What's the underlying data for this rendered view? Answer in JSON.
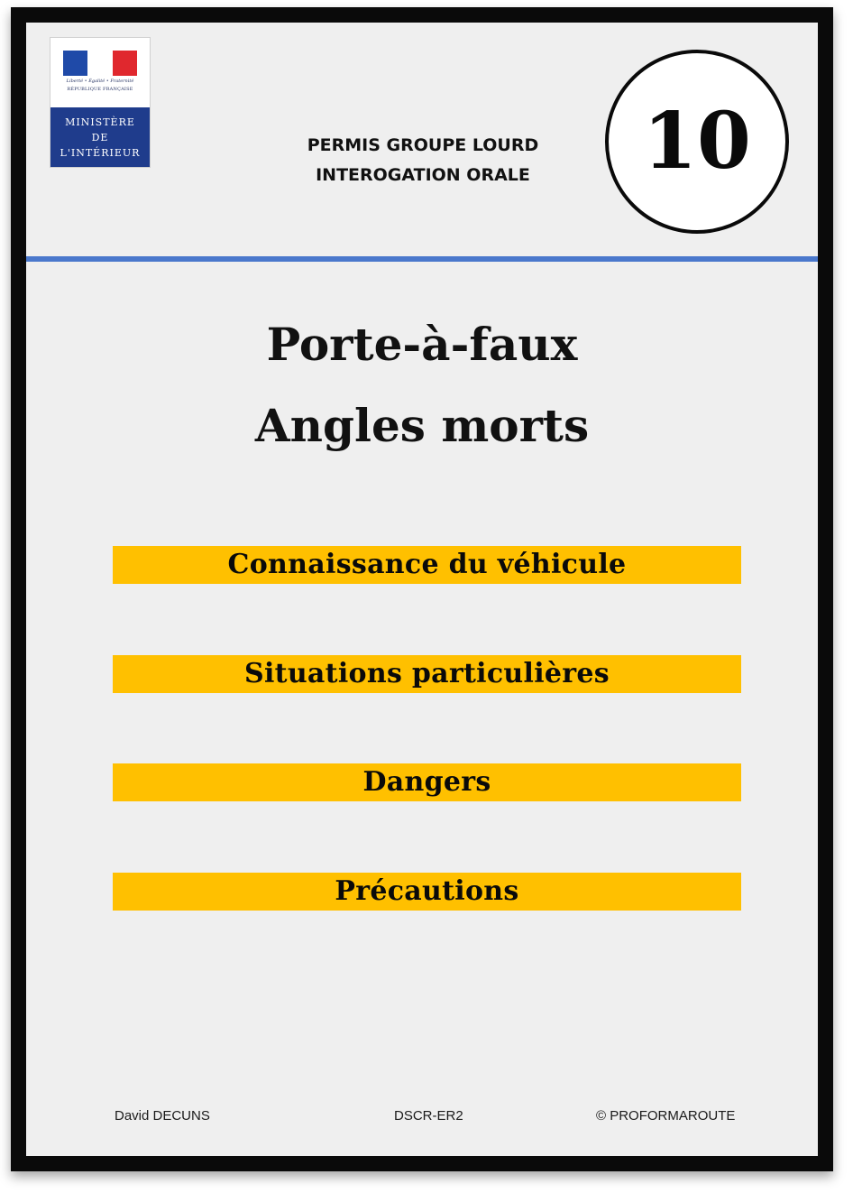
{
  "logo": {
    "motto": "Liberté • Égalité • Fraternité",
    "republique": "RÉPUBLIQUE FRANÇAISE",
    "ministry_lines": [
      "MINISTÈRE",
      "DE",
      "L'INTÉRIEUR"
    ],
    "flag_colors": [
      "#1f4aa8",
      "#ffffff",
      "#e0282e"
    ]
  },
  "header": {
    "line1": "PERMIS GROUPE LOURD",
    "line2": "INTEROGATION ORALE"
  },
  "badge": {
    "number": "10"
  },
  "title": {
    "line1": "Porte-à-faux",
    "line2": "Angles morts"
  },
  "topics": [
    "Connaissance du véhicule",
    "Situations particulières",
    "Dangers",
    "Précautions"
  ],
  "footer": {
    "author": "David DECUNS",
    "code": "DSCR-ER2",
    "copyright": "© PROFORMAROUTE"
  },
  "colors": {
    "topic_highlight": "#ffc000",
    "divider": "#4a78cc",
    "ministry_blue": "#1f3c8c"
  }
}
